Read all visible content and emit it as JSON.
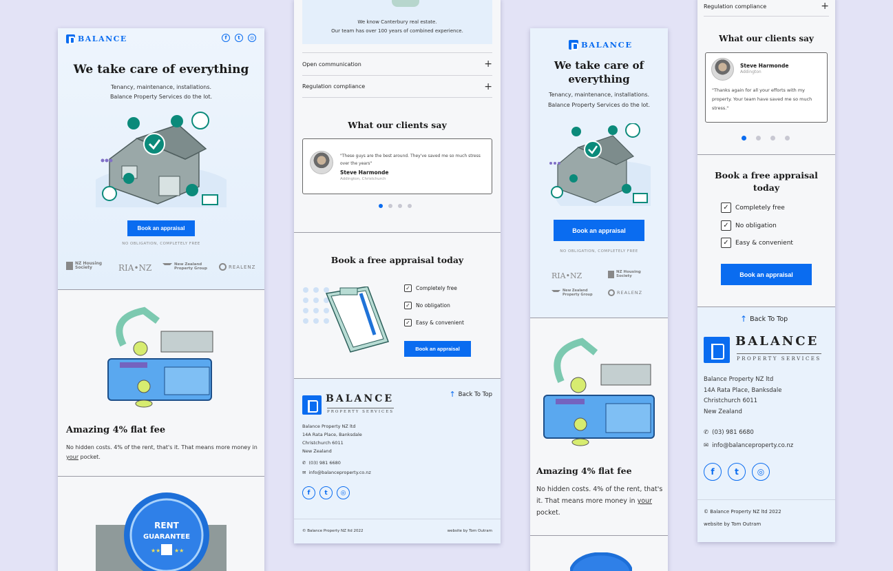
{
  "brand": {
    "name": "BALANCE",
    "sub": "PROPERTY SERVICES",
    "accent": "#0a6cf0",
    "bg": "#e3e3f6"
  },
  "social": {
    "facebook": "f",
    "twitter": "t",
    "instagram": "◎"
  },
  "hero": {
    "title": "We take care of everything",
    "line1": "Tenancy, maintenance, installations.",
    "line2": "Balance Property Services do the lot.",
    "subtitle_m": "Tenancy, maintenance, installations. Balance Property Services do the lot.",
    "cta": "Book an appraisal",
    "note": "NO OBLIGATION, COMPLETELY FREE"
  },
  "partners": {
    "nzhs1": "NZ Housing",
    "nzhs2": "Society",
    "ria": "RIA•NZ",
    "nzpg1": "New Zealand",
    "nzpg2": "Property Group",
    "realenz": "REALENZ"
  },
  "fee": {
    "title": "Amazing 4% flat fee",
    "body1": "No hidden costs. 4% of the rent, that's it. That means more money in ",
    "your": "your",
    "body2": " pocket."
  },
  "badge": {
    "line1": "RENT",
    "line2": "GUARANTEE"
  },
  "experience": {
    "line1": "We know Canterbury real estate.",
    "line2": "Our team has over 100 years of combined experience."
  },
  "accordion": {
    "item1": "Open communication",
    "item2": "Regulation compliance",
    "icon": "+"
  },
  "testimonials": {
    "heading": "What our clients say",
    "t1_quote": "\"These guys are the best around. They've saved me so much stress over the years\"",
    "t1_name": "Steve Harmonde",
    "t1_loc": "Addington, Christchurch",
    "t2_quote": "\"Thanks again for all your efforts with my property. Your team have saved me so much stress.\"",
    "t2_name": "Steve Harmonde",
    "t2_loc": "Addington"
  },
  "appraisal": {
    "heading": "Book a free appraisal today",
    "heading_m1": "Book a free appraisal",
    "heading_m2": "today",
    "items": [
      "Completely free",
      "No obligation",
      "Easy & convenient"
    ],
    "cta": "Book an appraisal"
  },
  "footer": {
    "back_top": "Back To Top",
    "addr1": "Balance Property NZ ltd",
    "addr2": "14A Rata Place, Banksdale",
    "addr3": "Christchurch 6011",
    "addr4": "New Zealand",
    "phone": "(03) 981 6680",
    "email": "info@balanceproperty.co.nz",
    "copyright": "© Balance Property NZ ltd 2022",
    "credit": "website by Tom Outram"
  }
}
